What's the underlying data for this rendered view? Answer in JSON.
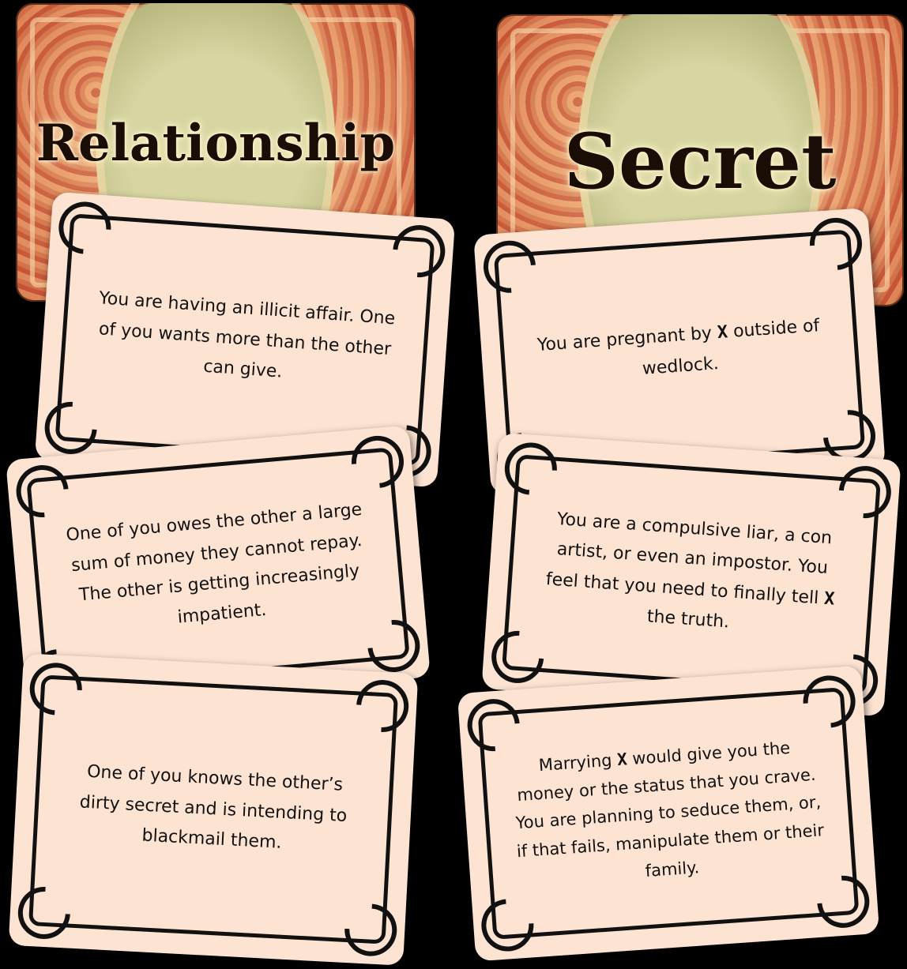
{
  "decks": [
    {
      "title": "Relationship"
    },
    {
      "title": "Secret"
    }
  ],
  "cards": [
    {
      "segments": [
        "You are having an illicit affair. One of you wants more than the other can give."
      ]
    },
    {
      "segments": [
        "You are pregnant by ",
        "X",
        " outside of wedlock."
      ]
    },
    {
      "segments": [
        "One of you owes the other a large sum of money they cannot repay. The other is getting increasingly impatient."
      ]
    },
    {
      "segments": [
        "You are a compulsive liar, a con artist, or even an impostor. You feel that you need to finally tell ",
        "X",
        " the truth."
      ]
    },
    {
      "segments": [
        "One of you knows the other’s dirty secret and is intending to blackmail them."
      ]
    },
    {
      "segments": [
        "Marrying ",
        "X",
        " would give you the money or the status that you crave. You are planning to seduce them, or, if that fails, manipulate them or their family."
      ]
    }
  ]
}
